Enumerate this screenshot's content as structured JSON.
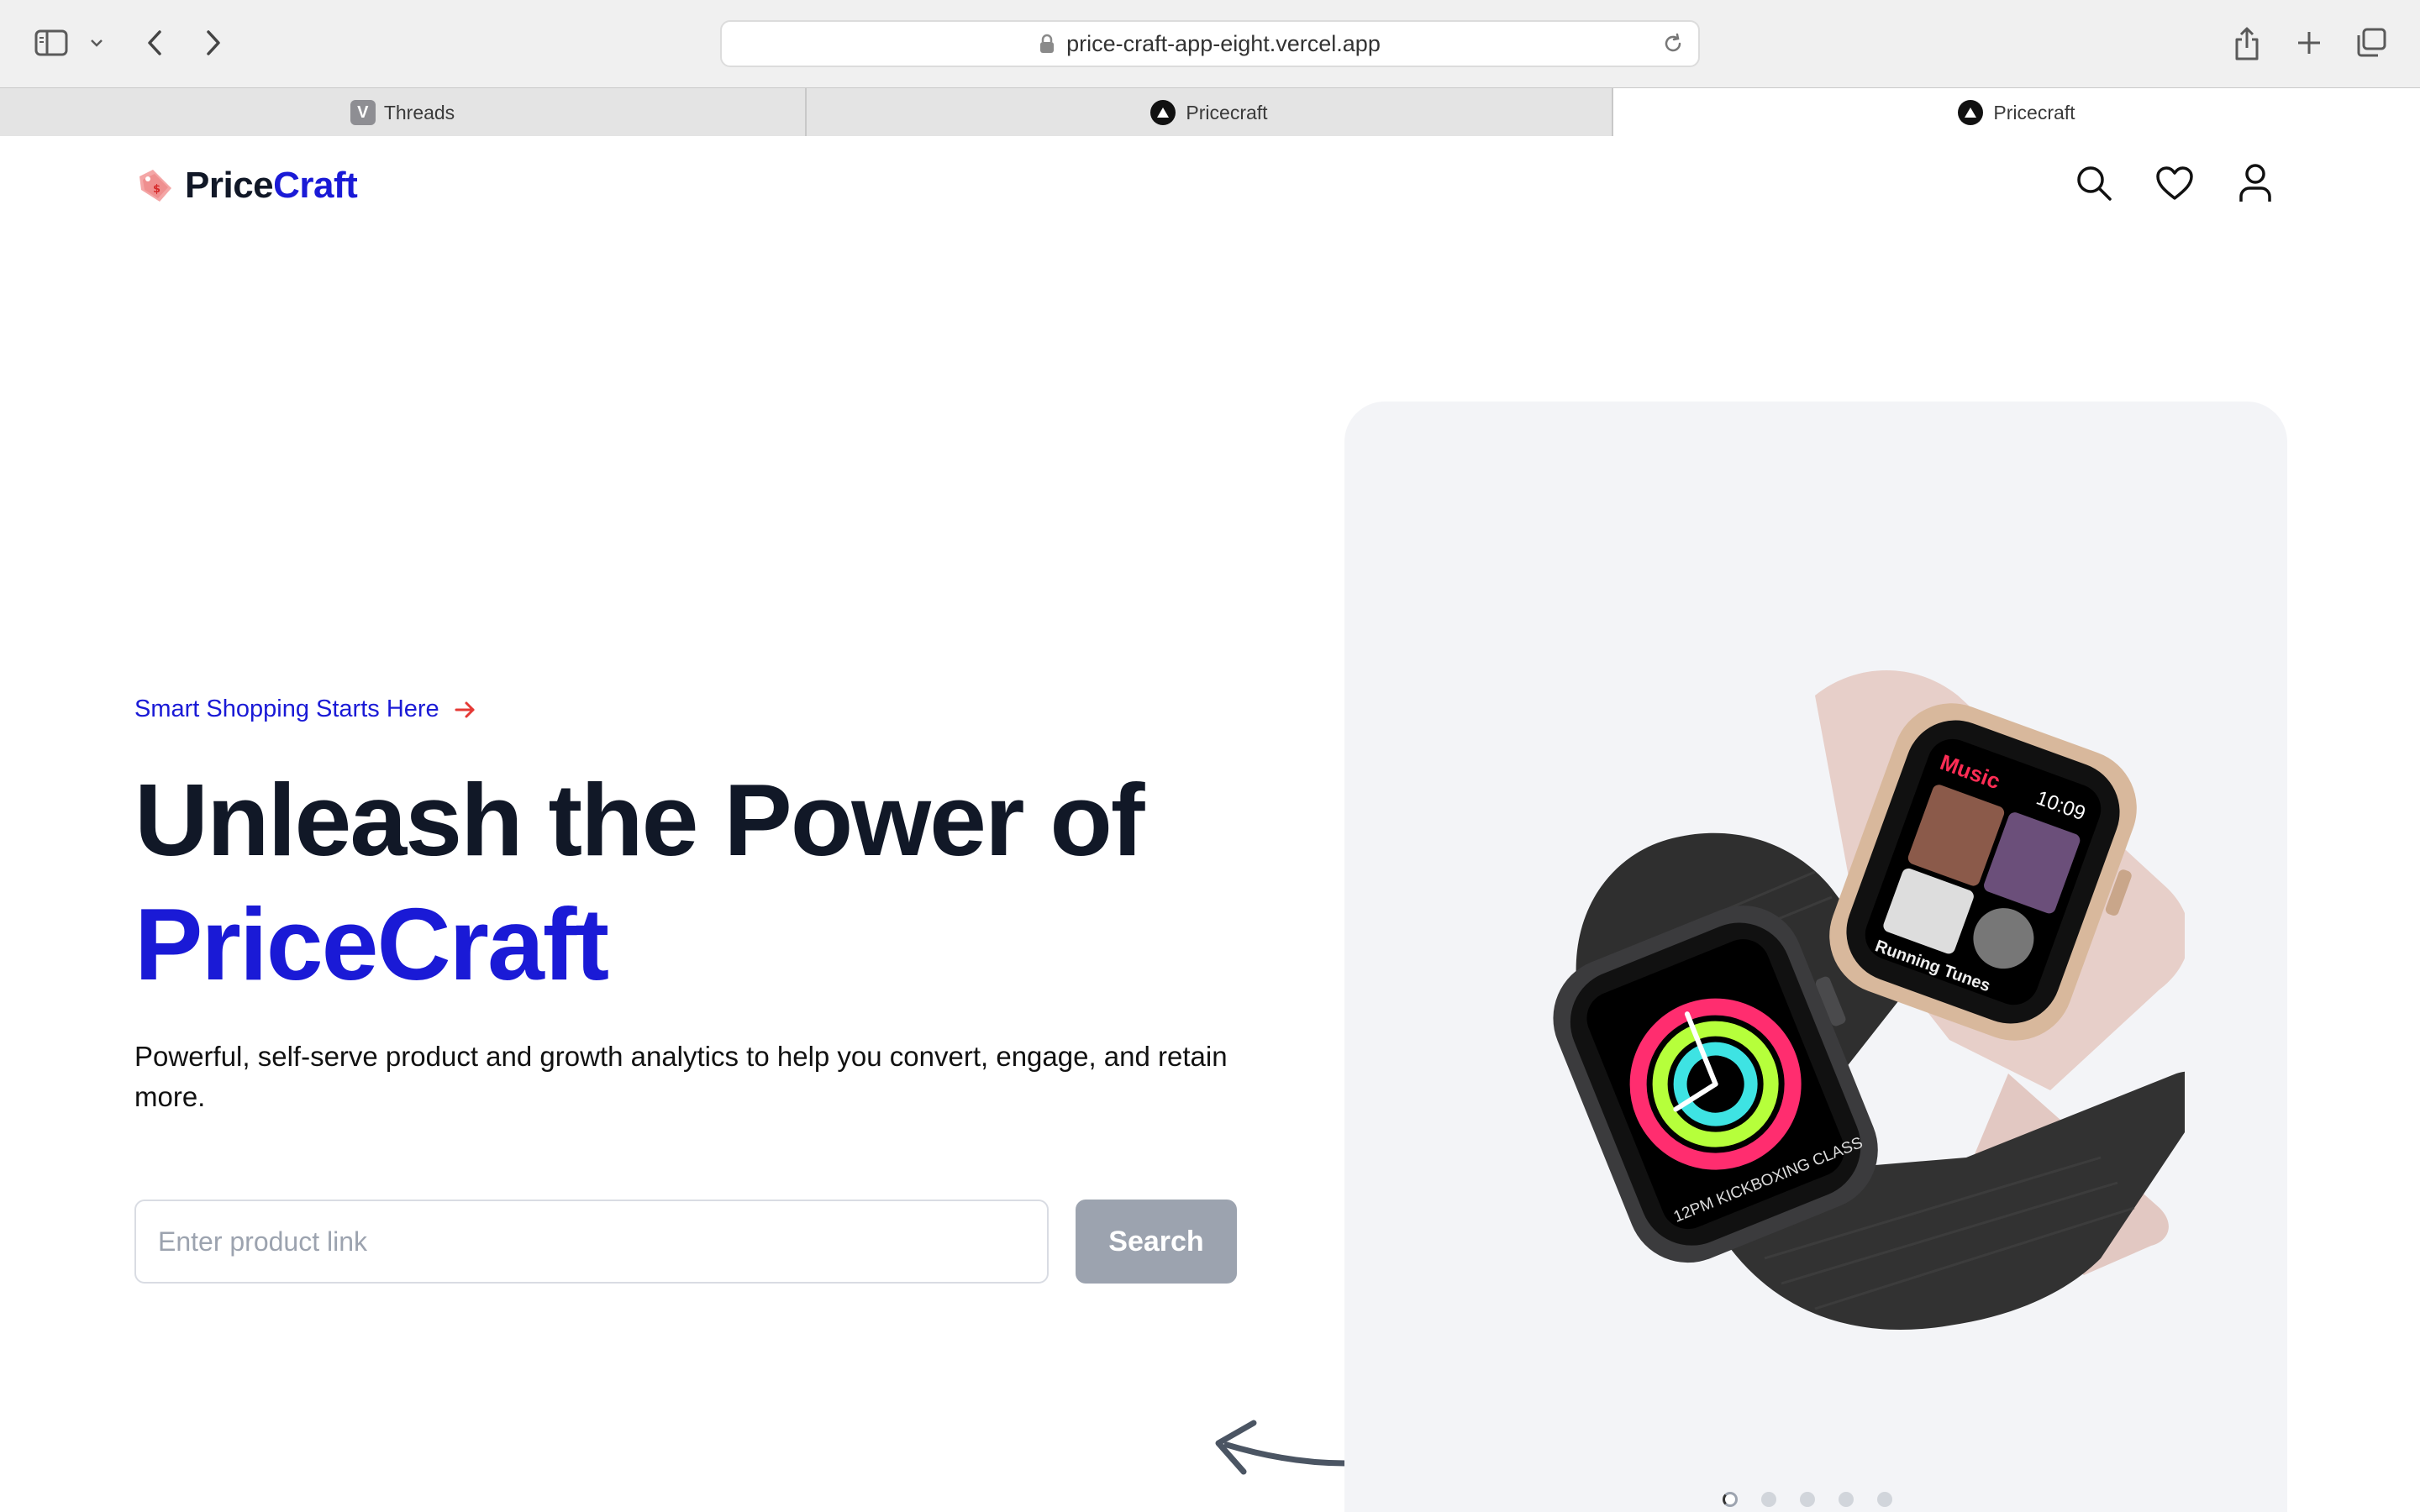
{
  "browser": {
    "url": "price-craft-app-eight.vercel.app",
    "tabs": [
      {
        "title": "Threads",
        "favicon": "V"
      },
      {
        "title": "Pricecraft",
        "favicon": "triangle-logo"
      },
      {
        "title": "Pricecraft",
        "favicon": "triangle-logo",
        "active": true
      }
    ]
  },
  "header": {
    "logo_part1": "Price",
    "logo_part2": "Craft",
    "icons": [
      "search-icon",
      "heart-icon",
      "user-icon"
    ]
  },
  "hero": {
    "tagline": "Smart Shopping Starts Here",
    "title_line1": "Unleash the Power of",
    "title_line2": "PriceCraft",
    "description": "Powerful, self-serve product and growth analytics to help you convert, engage, and retain more.",
    "search_placeholder": "Enter product link",
    "search_value": "",
    "search_button": "Search",
    "carousel_active_index": 0,
    "carousel_count": 5,
    "watch_screen_texts": [
      "Music",
      "10:09",
      "Running Tunes",
      "12PM KICKBOXING CLASS"
    ]
  },
  "colors": {
    "brand_blue": "#1a1ad6",
    "text_dark": "#111827",
    "button_gray": "#9ca3af",
    "card_bg": "#f3f4f7",
    "arrow_red": "#e53935"
  }
}
